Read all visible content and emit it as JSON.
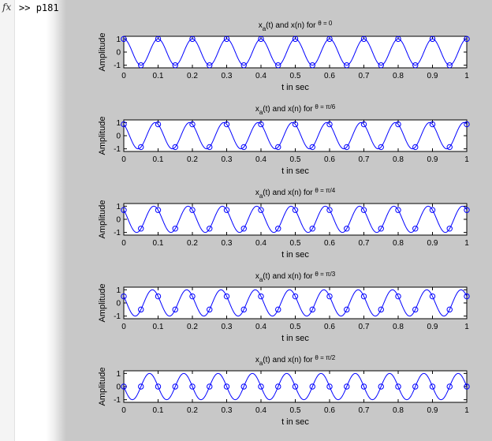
{
  "command_window": {
    "fx_icon": "fx",
    "prompt": ">>",
    "command": "p181"
  },
  "colors": {
    "figure_background": "#c8c8c8",
    "axes_background": "#ffffff",
    "series": "#0000ff",
    "axis": "#000000"
  },
  "chart_data": [
    {
      "type": "line",
      "title_parts": {
        "base": "x",
        "sub": "a",
        "rest": "(t) and x(n) for ",
        "theta": "θ",
        "rest2": " = 0"
      },
      "theta_value": 0,
      "series": [
        {
          "kind": "continuous",
          "function": "cos(2*pi*10*t + theta)",
          "t_range": [
            0,
            1
          ]
        },
        {
          "kind": "samples",
          "marker": "o",
          "sample_period": 0.05,
          "t_range": [
            0,
            1
          ]
        }
      ],
      "xlabel": "t in sec",
      "ylabel": "Amplitude",
      "xlim": [
        0,
        1
      ],
      "ylim": [
        -1.2,
        1.2
      ],
      "xticks": [
        0,
        0.1,
        0.2,
        0.3,
        0.4,
        0.5,
        0.6,
        0.7,
        0.8,
        0.9,
        1
      ],
      "xtick_labels": [
        "0",
        "0.1",
        "0.2",
        "0.3",
        "0.4",
        "0.5",
        "0.6",
        "0.7",
        "0.8",
        "0.9",
        "1"
      ],
      "yticks": [
        -1,
        0,
        1
      ],
      "ytick_labels": [
        "-1",
        "0",
        "1"
      ],
      "grid": false
    },
    {
      "type": "line",
      "title_parts": {
        "base": "x",
        "sub": "a",
        "rest": "(t) and x(n) for ",
        "theta": "θ",
        "rest2": " = π/6"
      },
      "theta_value": 0.5236,
      "series": [
        {
          "kind": "continuous",
          "function": "cos(2*pi*10*t + theta)",
          "t_range": [
            0,
            1
          ]
        },
        {
          "kind": "samples",
          "marker": "o",
          "sample_period": 0.05,
          "t_range": [
            0,
            1
          ]
        }
      ],
      "xlabel": "t in sec",
      "ylabel": "Amplitude",
      "xlim": [
        0,
        1
      ],
      "ylim": [
        -1.2,
        1.2
      ],
      "xticks": [
        0,
        0.1,
        0.2,
        0.3,
        0.4,
        0.5,
        0.6,
        0.7,
        0.8,
        0.9,
        1
      ],
      "xtick_labels": [
        "0",
        "0.1",
        "0.2",
        "0.3",
        "0.4",
        "0.5",
        "0.6",
        "0.7",
        "0.8",
        "0.9",
        "1"
      ],
      "yticks": [
        -1,
        0,
        1
      ],
      "ytick_labels": [
        "-1",
        "0",
        "1"
      ],
      "grid": false
    },
    {
      "type": "line",
      "title_parts": {
        "base": "x",
        "sub": "a",
        "rest": "(t) and x(n) for ",
        "theta": "θ",
        "rest2": " = π/4"
      },
      "theta_value": 0.7854,
      "series": [
        {
          "kind": "continuous",
          "function": "cos(2*pi*10*t + theta)",
          "t_range": [
            0,
            1
          ]
        },
        {
          "kind": "samples",
          "marker": "o",
          "sample_period": 0.05,
          "t_range": [
            0,
            1
          ]
        }
      ],
      "xlabel": "t in sec",
      "ylabel": "Amplitude",
      "xlim": [
        0,
        1
      ],
      "ylim": [
        -1.2,
        1.2
      ],
      "xticks": [
        0,
        0.1,
        0.2,
        0.3,
        0.4,
        0.5,
        0.6,
        0.7,
        0.8,
        0.9,
        1
      ],
      "xtick_labels": [
        "0",
        "0.1",
        "0.2",
        "0.3",
        "0.4",
        "0.5",
        "0.6",
        "0.7",
        "0.8",
        "0.9",
        "1"
      ],
      "yticks": [
        -1,
        0,
        1
      ],
      "ytick_labels": [
        "-1",
        "0",
        "1"
      ],
      "grid": false
    },
    {
      "type": "line",
      "title_parts": {
        "base": "x",
        "sub": "a",
        "rest": "(t) and x(n) for ",
        "theta": "θ",
        "rest2": " = π/3"
      },
      "theta_value": 1.0472,
      "series": [
        {
          "kind": "continuous",
          "function": "cos(2*pi*10*t + theta)",
          "t_range": [
            0,
            1
          ]
        },
        {
          "kind": "samples",
          "marker": "o",
          "sample_period": 0.05,
          "t_range": [
            0,
            1
          ]
        }
      ],
      "xlabel": "t in sec",
      "ylabel": "Amplitude",
      "xlim": [
        0,
        1
      ],
      "ylim": [
        -1.2,
        1.2
      ],
      "xticks": [
        0,
        0.1,
        0.2,
        0.3,
        0.4,
        0.5,
        0.6,
        0.7,
        0.8,
        0.9,
        1
      ],
      "xtick_labels": [
        "0",
        "0.1",
        "0.2",
        "0.3",
        "0.4",
        "0.5",
        "0.6",
        "0.7",
        "0.8",
        "0.9",
        "1"
      ],
      "yticks": [
        -1,
        0,
        1
      ],
      "ytick_labels": [
        "-1",
        "0",
        "1"
      ],
      "grid": false
    },
    {
      "type": "line",
      "title_parts": {
        "base": "x",
        "sub": "a",
        "rest": "(t) and x(n) for ",
        "theta": "θ",
        "rest2": " = π/2"
      },
      "theta_value": 1.5708,
      "series": [
        {
          "kind": "continuous",
          "function": "cos(2*pi*10*t + theta)",
          "t_range": [
            0,
            1
          ]
        },
        {
          "kind": "samples",
          "marker": "o",
          "sample_period": 0.05,
          "t_range": [
            0,
            1
          ]
        }
      ],
      "xlabel": "t in sec",
      "ylabel": "Amplitude",
      "xlim": [
        0,
        1
      ],
      "ylim": [
        -1.2,
        1.2
      ],
      "xticks": [
        0,
        0.1,
        0.2,
        0.3,
        0.4,
        0.5,
        0.6,
        0.7,
        0.8,
        0.9,
        1
      ],
      "xtick_labels": [
        "0",
        "0.1",
        "0.2",
        "0.3",
        "0.4",
        "0.5",
        "0.6",
        "0.7",
        "0.8",
        "0.9",
        "1"
      ],
      "yticks": [
        -1,
        0,
        1
      ],
      "ytick_labels": [
        "-1",
        "0",
        "1"
      ],
      "grid": false
    }
  ]
}
